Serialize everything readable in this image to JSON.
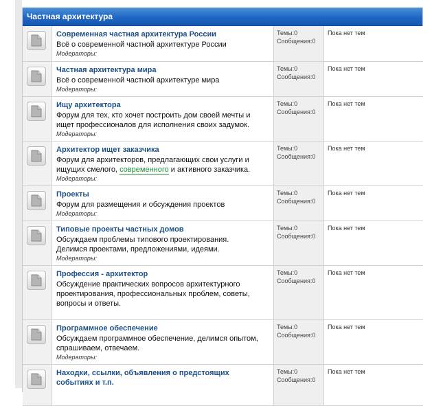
{
  "category": {
    "title": "Частная архитектура"
  },
  "labels": {
    "moderators": "Модераторы:"
  },
  "forums": [
    {
      "title": "Современная частная архитектура России",
      "desc": "Всё о современной частной архитектуре России",
      "topics": "Темы:0",
      "posts": "Сообщения:0",
      "last": "Пока нет тем"
    },
    {
      "title": "Частная архитектура мира",
      "desc": "Всё о современной частной архитектуре мира",
      "topics": "Темы:0",
      "posts": "Сообщения:0",
      "last": "Пока нет тем"
    },
    {
      "title": "Ищу архитектора",
      "desc_lines": [
        "Форум для тех, кто хочет построить дом своей мечты и",
        "ищет профессионалов для исполнения своих задумок."
      ],
      "topics": "Темы:0",
      "posts": "Сообщения:0",
      "last": "Пока нет тем"
    },
    {
      "title": "Архитектор ищет заказчика",
      "desc_lines": [
        "Форум для архитекторов, предлагающих свои услуги и",
        "ищущих смелого,"
      ],
      "desc_highlight": "современного",
      "desc_tail": "и активного заказчика.",
      "topics": "Темы:0",
      "posts": "Сообщения:0",
      "last": "Пока нет тем"
    },
    {
      "title": "Проекты",
      "desc": "Форум для размещения и обсуждения проектов",
      "topics": "Темы:0",
      "posts": "Сообщения:0",
      "last": "Пока нет тем"
    },
    {
      "title": "Типовые проекты частных домов",
      "desc_lines": [
        "Обсуждаем проблемы типового проектирования.",
        "Делимся проектами, предложениями, идеями."
      ],
      "topics": "Темы:0",
      "posts": "Сообщения:0",
      "last": "Пока нет тем"
    },
    {
      "title": "Профессия - архитектор",
      "desc_lines": [
        "Обсуждение практических вопросов архитектурного",
        "проектирования, профессиональных проблем, советы,",
        "вопросы и ответы."
      ],
      "topics": "Темы:0",
      "posts": "Сообщения:0",
      "last": "Пока нет тем"
    },
    {
      "title": "Программное обеспечение",
      "desc_lines": [
        "Обсуждаем программное обеспечение, делимся опытом,",
        "спрашиваем, отвечаем."
      ],
      "topics": "Темы:0",
      "posts": "Сообщения:0",
      "last": "Пока нет тем"
    },
    {
      "title_lines": [
        "Находки, ссылки, объявления о предстоящих",
        "событиях и т.п."
      ],
      "topics": "Темы:0",
      "posts": "Сообщения:0",
      "last": "Пока нет тем"
    }
  ],
  "icons": {
    "forum_icon": "document-icon"
  },
  "colors": {
    "header_top": "#4a90d9",
    "header_bottom": "#1557b0",
    "title_link": "#1c4f86",
    "highlight": "#23883a"
  }
}
